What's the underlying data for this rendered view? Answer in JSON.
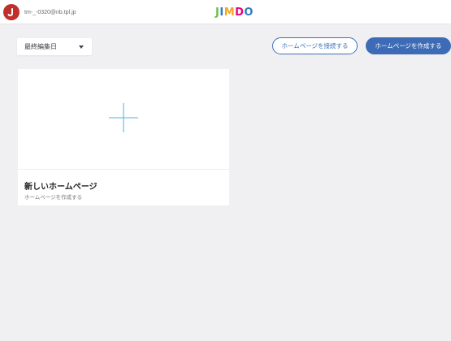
{
  "header": {
    "account_email": "tm-_-0320@nb.tpl.jp",
    "logo_text": "JIMDO",
    "logo_colors": [
      "#6cc04a",
      "#2f7bbf",
      "#f5a623",
      "#e6007e",
      "#2f7bbf"
    ]
  },
  "toolbar": {
    "sort_selected": "最終編集日",
    "connect_button_label": "ホームページを接続する",
    "create_button_label": "ホームページを作成する"
  },
  "new_site_card": {
    "title": "新しいホームページ",
    "subtitle": "ホームページを作成する",
    "icon": "plus-icon"
  },
  "colors": {
    "accent": "#3d6bb5",
    "avatar_bg": "#c0302a",
    "plus_line": "#4ab3e3",
    "background": "#f0f0f3"
  }
}
